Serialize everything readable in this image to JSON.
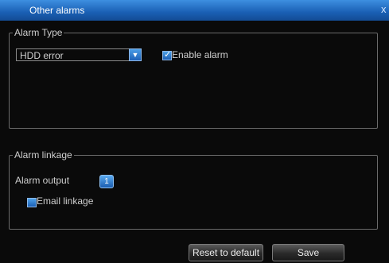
{
  "window": {
    "title": "Other alarms",
    "close_glyph": "x"
  },
  "alarm_type": {
    "legend": "Alarm Type",
    "select_value": "HDD error",
    "enable_label": "Enable alarm",
    "enable_checked": true
  },
  "alarm_linkage": {
    "legend": "Alarm linkage",
    "output_label": "Alarm output",
    "output_channel": "1",
    "email_label": "Email linkage",
    "email_checked": false
  },
  "buttons": {
    "reset": "Reset to default",
    "save": "Save"
  },
  "icons": {
    "dropdown": "chevron-down-icon",
    "check": "checkmark-icon",
    "close": "close-icon"
  },
  "colors": {
    "title_bar": "#1a5fb4",
    "accent": "#3d8fe0",
    "background": "#0a0a0a"
  }
}
